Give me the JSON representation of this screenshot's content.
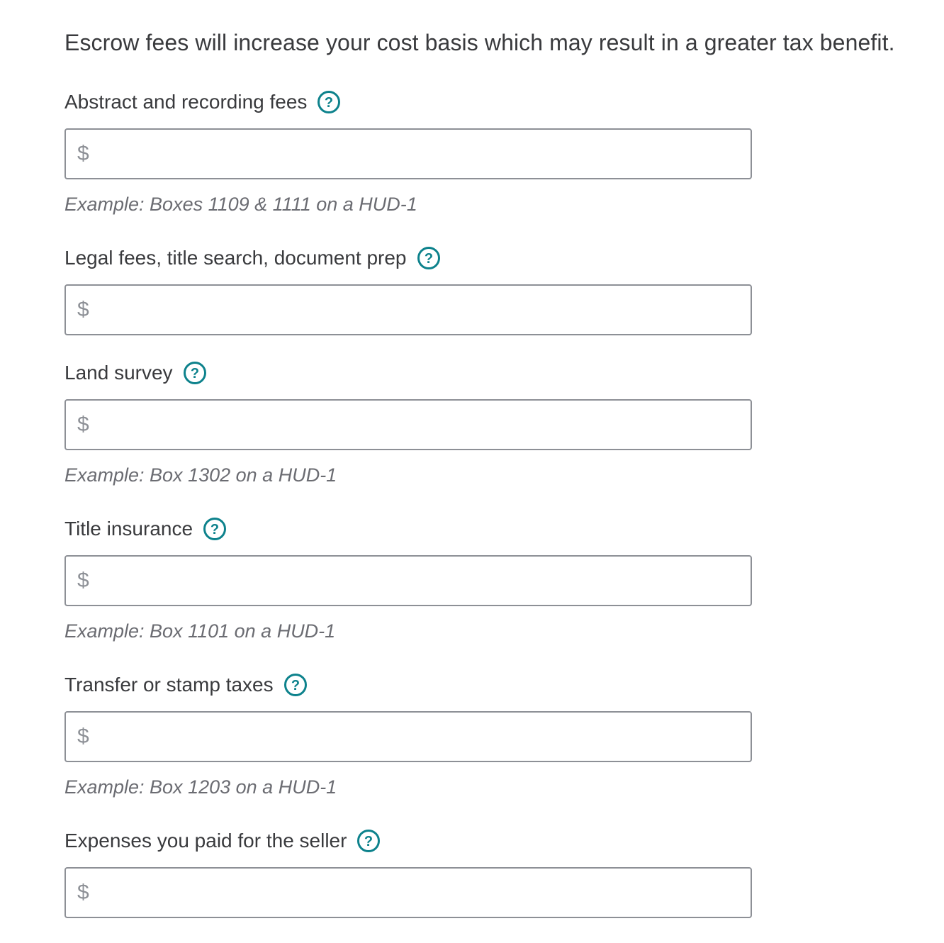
{
  "intro": "Escrow fees will increase your cost basis which may result in a greater tax benefit.",
  "accent_color": "#0d828c",
  "icons": {
    "help": "question-circle-icon"
  },
  "fields": [
    {
      "label": "Abstract and recording fees",
      "currency": "$",
      "value": "",
      "example": "Example: Boxes 1109 & 1111 on a HUD-1"
    },
    {
      "label": "Legal fees, title search, document prep",
      "currency": "$",
      "value": ""
    },
    {
      "label": "Land survey",
      "currency": "$",
      "value": "",
      "example": "Example: Box 1302 on a HUD-1"
    },
    {
      "label": "Title insurance",
      "currency": "$",
      "value": "",
      "example": "Example: Box 1101 on a HUD-1"
    },
    {
      "label": "Transfer or stamp taxes",
      "currency": "$",
      "value": "",
      "example": "Example: Box 1203 on a HUD-1"
    },
    {
      "label": "Expenses you paid for the seller",
      "currency": "$",
      "value": ""
    }
  ]
}
